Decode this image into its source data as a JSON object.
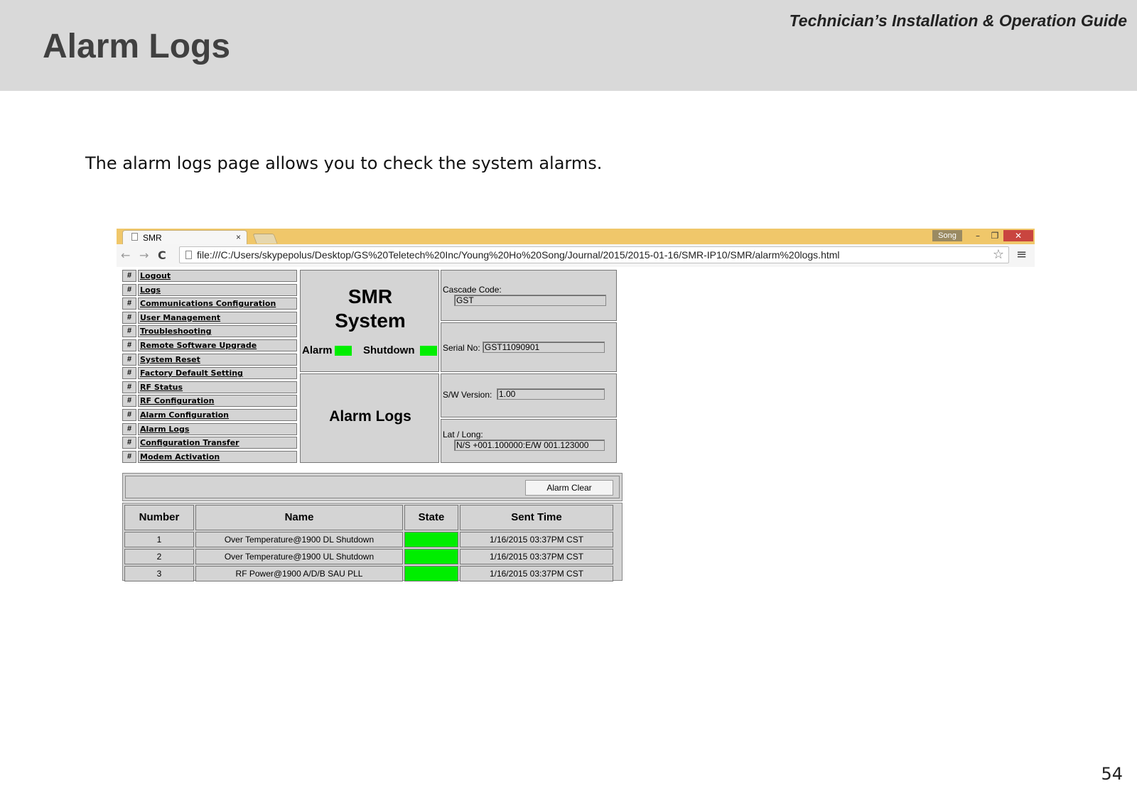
{
  "slide": {
    "title": "Alarm Logs",
    "guide_title": "Technician’s Installation & Operation Guide",
    "intro": "The alarm logs page allows you to check the system alarms.",
    "page_number": "54"
  },
  "browser": {
    "tab_title": "SMR",
    "tab_close": "×",
    "user_badge": "Song",
    "minimize": "–",
    "maximize": "❐",
    "close": "✕",
    "back": "←",
    "forward": "→",
    "reload": "C",
    "address": "file:///C:/Users/skypepolus/Desktop/GS%20Teletech%20Inc/Young%20Ho%20Song/Journal/2015/2015-01-16/SMR-IP10/SMR/alarm%20logs.html",
    "bookmark_star": "☆",
    "menu": "≡"
  },
  "nav": {
    "marker": "#",
    "items": [
      "Logout",
      "Logs",
      "Communications Configuration",
      "User Management",
      "Troubleshooting",
      "Remote Software Upgrade",
      "System Reset",
      "Factory Default Setting",
      "RF Status",
      "RF Configuration",
      "Alarm Configuration",
      "Alarm Logs",
      "Configuration Transfer",
      "Modem Activation"
    ]
  },
  "system": {
    "title_line1": "SMR",
    "title_line2": "System",
    "alarm_label": "Alarm",
    "shutdown_label": "Shutdown",
    "alarm_color": "#00ee00",
    "shutdown_color": "#00ee00"
  },
  "page_heading": "Alarm Logs",
  "info": {
    "cascade_label": "Cascade Code:",
    "cascade_value": "GST",
    "serial_label": "Serial No:",
    "serial_value": "GST11090901",
    "sw_label": "S/W Version:",
    "sw_value": "1.00",
    "latlong_label": "Lat / Long:",
    "latlong_value": "N/S +001.100000:E/W 001.123000"
  },
  "alarm_clear_label": "Alarm Clear",
  "log_table": {
    "headers": [
      "Number",
      "Name",
      "State",
      "Sent Time"
    ],
    "rows": [
      {
        "number": "1",
        "name": "Over Temperature@1900 DL Shutdown",
        "state_color": "#00ee00",
        "sent_time": "1/16/2015 03:37PM CST"
      },
      {
        "number": "2",
        "name": "Over Temperature@1900 UL Shutdown",
        "state_color": "#00ee00",
        "sent_time": "1/16/2015 03:37PM CST"
      },
      {
        "number": "3",
        "name": "RF Power@1900 A/D/B SAU PLL",
        "state_color": "#00ee00",
        "sent_time": "1/16/2015 03:37PM CST"
      }
    ]
  }
}
